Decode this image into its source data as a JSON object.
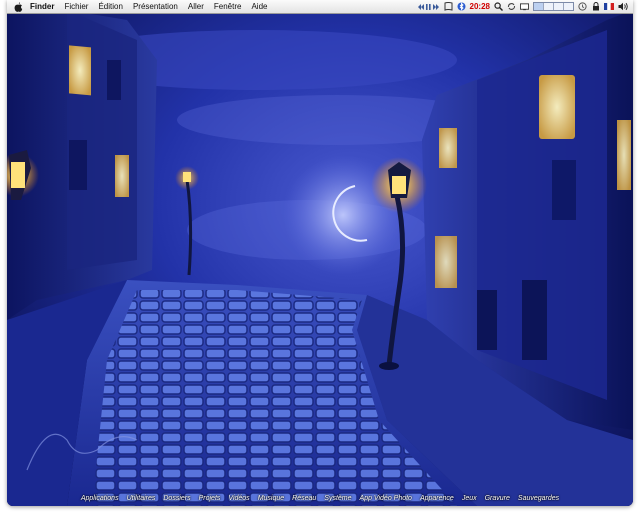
{
  "menubar": {
    "app_name": "Finder",
    "items": [
      "Fichier",
      "Édition",
      "Présentation",
      "Aller",
      "Fenêtre",
      "Aide"
    ]
  },
  "status": {
    "time": "20:28",
    "icons": [
      "media-controls-icon",
      "script-icon",
      "bluetooth-icon",
      "spotlight-icon",
      "sync-icon",
      "display-icon",
      "spaces-icon",
      "time-machine-icon",
      "lock-icon",
      "flag-icon",
      "volume-icon"
    ]
  },
  "folders": [
    "Applications",
    "Utilitaires",
    "Dossiers",
    "Projets",
    "Vidéos",
    "Musique",
    "Réseau",
    "Système",
    "App Vidéo Photo",
    "Apparence",
    "Jeux",
    "Gravure",
    "Sauvegardes"
  ],
  "colors": {
    "sky": "#1a2a8a",
    "moon": "#ffffff",
    "lamp_glow": "#ffd060",
    "clock": "#d00000"
  }
}
